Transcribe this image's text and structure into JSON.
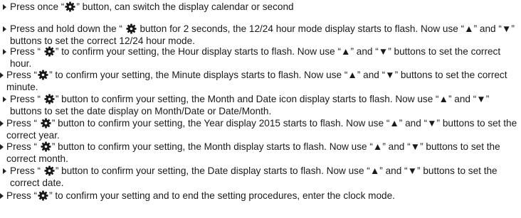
{
  "instructions": [
    {
      "before": "Press once “",
      "after": "” button, can switch the display calendar or second"
    },
    {
      "before": "Press and hold down the “ ",
      "after": " button for 2 seconds, the 12/24 hour mode display starts to flash. Now use “▲” and “▼” buttons to set the correct 12/24 hour mode."
    },
    {
      "before": "Press “ ",
      "after": "” to confirm your setting, the Hour display starts to flash. Now use “▲” and “▼” buttons to set the correct hour."
    },
    {
      "before": "Press “",
      "after": "” to confirm your setting, the Minute displays starts to flash. Now use “▲” and “▼” buttons to set the correct minute."
    },
    {
      "before": "Press “ ",
      "after": "” button to confirm your setting, the Month and Date icon display starts to flash. Now use “▲” and “▼” buttons to set the date display on Month/Date or Date/Month."
    },
    {
      "before": "Press “ ",
      "after": "” button to confirm your setting, the Year display 2015 starts to flash. Now use “▲” and “▼” buttons to set the correct year."
    },
    {
      "before": "Press “ ",
      "after": "” button to confirm your setting, the Month display starts to flash. Now use “▲” and “▼” buttons to set the correct month."
    },
    {
      "before": "Press “ ",
      "after": "” button to confirm your setting, the Date display starts to flash. Now use “▲” and “▼” buttons to set the correct date."
    },
    {
      "before": "Press “",
      "after": "” to confirm your setting and to end the setting procedures, enter the clock mode."
    }
  ],
  "icons": {
    "bullet": "triangle-right-icon",
    "setting_button": "gear-icon"
  }
}
